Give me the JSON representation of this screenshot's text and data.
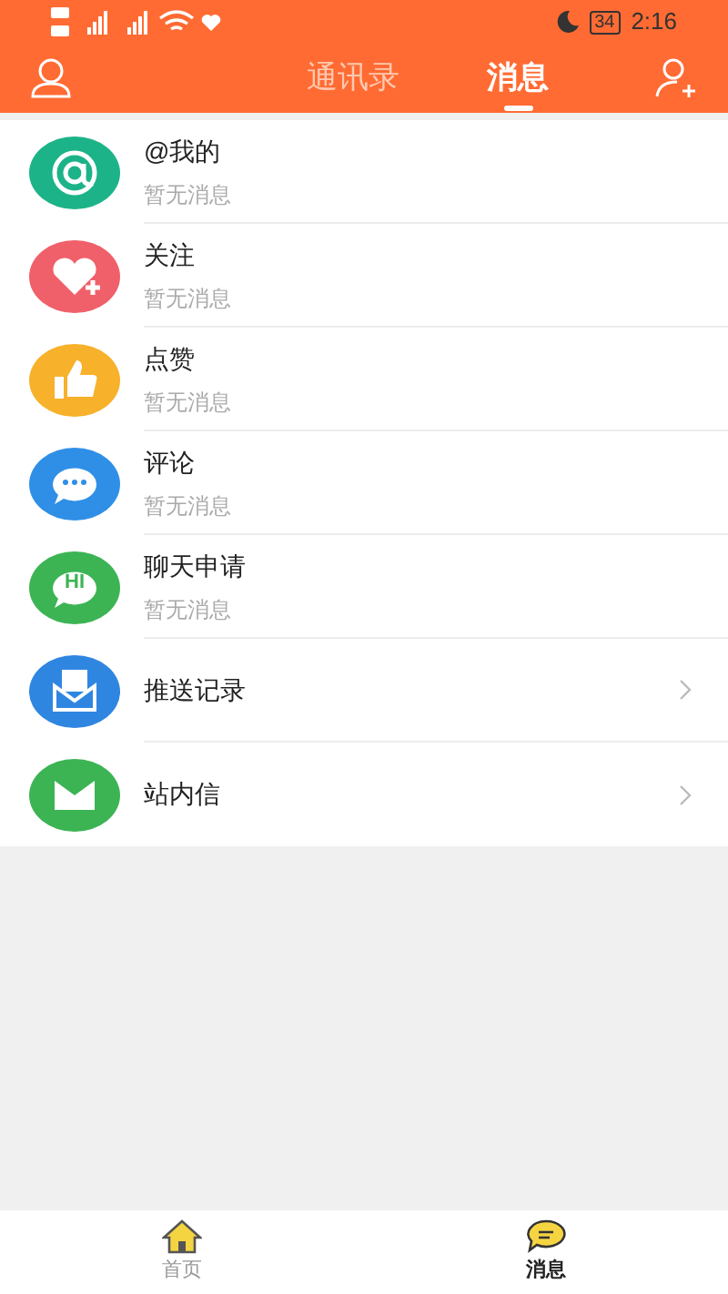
{
  "status_bar": {
    "battery": "34",
    "time": "2:16"
  },
  "tabs": [
    {
      "label": "通讯录",
      "selected": false
    },
    {
      "label": "消息",
      "selected": true
    }
  ],
  "items": [
    {
      "kind": "message",
      "color": "#1db388",
      "title": "@我的",
      "subtitle": "暂无消息"
    },
    {
      "kind": "message",
      "color": "#f0606a",
      "title": "关注",
      "subtitle": "暂无消息"
    },
    {
      "kind": "message",
      "color": "#f7b12a",
      "title": "点赞",
      "subtitle": "暂无消息"
    },
    {
      "kind": "message",
      "color": "#2f8fe6",
      "title": "评论",
      "subtitle": "暂无消息"
    },
    {
      "kind": "message",
      "color": "#3cb454",
      "icon_text": "HI",
      "title": "聊天申请",
      "subtitle": "暂无消息"
    },
    {
      "kind": "link",
      "color": "#2f86e0",
      "title": "推送记录"
    },
    {
      "kind": "link",
      "color": "#3cb454",
      "title": "站内信"
    }
  ],
  "bottom_nav": [
    {
      "label": "首页",
      "selected": false
    },
    {
      "label": "消息",
      "selected": true
    }
  ]
}
